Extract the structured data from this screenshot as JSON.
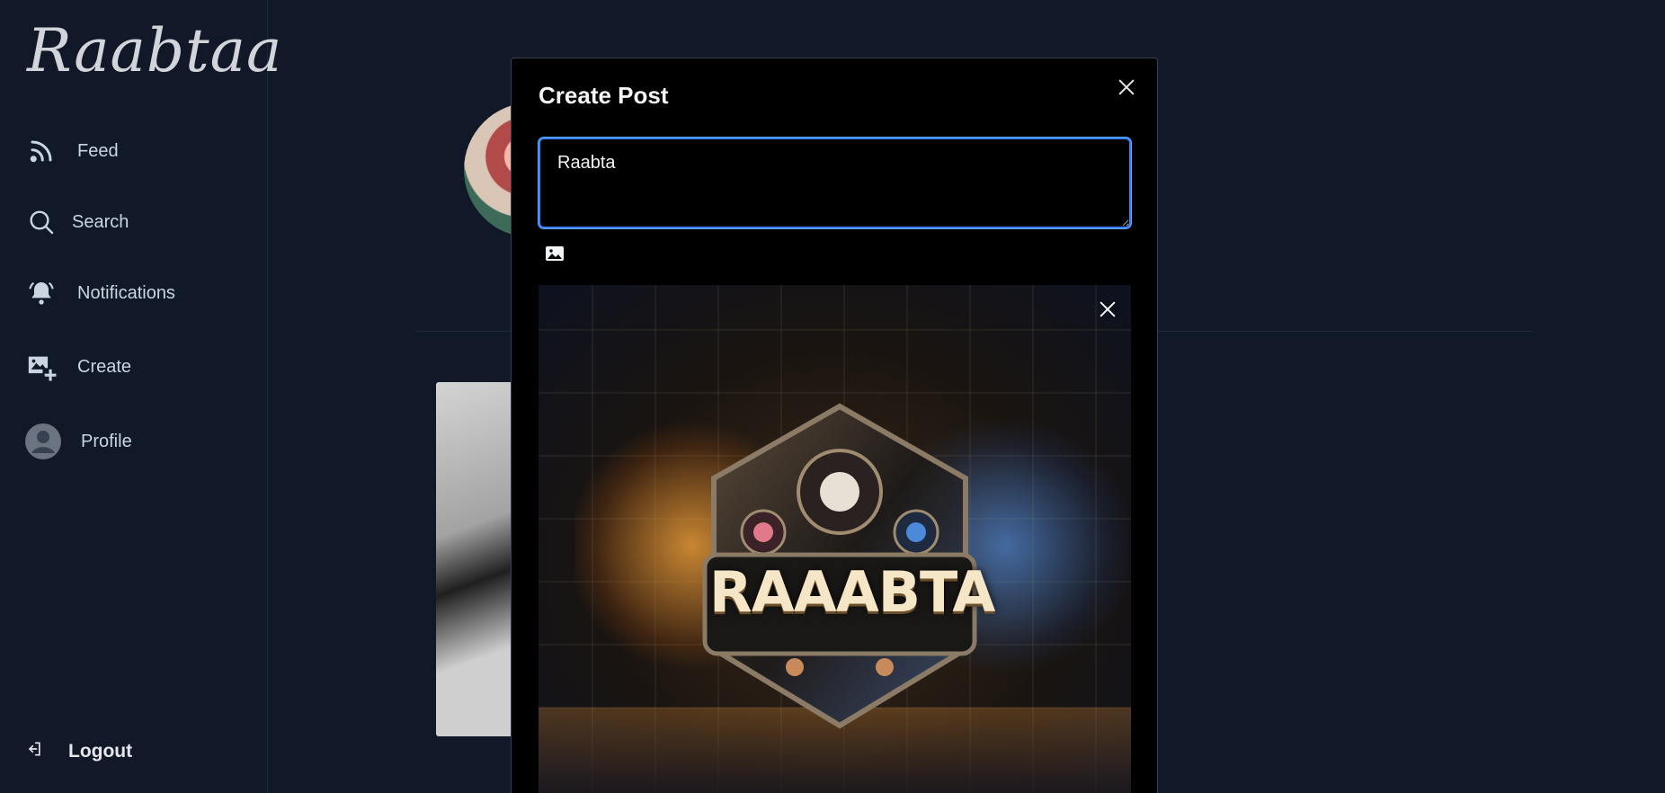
{
  "app": {
    "logo": "Raabtaa"
  },
  "sidebar": {
    "items": [
      {
        "label": "Feed",
        "icon": "rss-icon"
      },
      {
        "label": "Search",
        "icon": "search-icon"
      },
      {
        "label": "Notifications",
        "icon": "bell-icon"
      },
      {
        "label": "Create",
        "icon": "add-image-icon"
      },
      {
        "label": "Profile",
        "icon": "user-avatar-icon"
      }
    ],
    "logout": "Logout"
  },
  "modal": {
    "title": "Create Post",
    "text_value": "Raabta",
    "preview_image_text": "RAAABTA"
  },
  "colors": {
    "background": "#111827",
    "modal_bg": "#000000",
    "focus_border": "#3b82f6"
  }
}
